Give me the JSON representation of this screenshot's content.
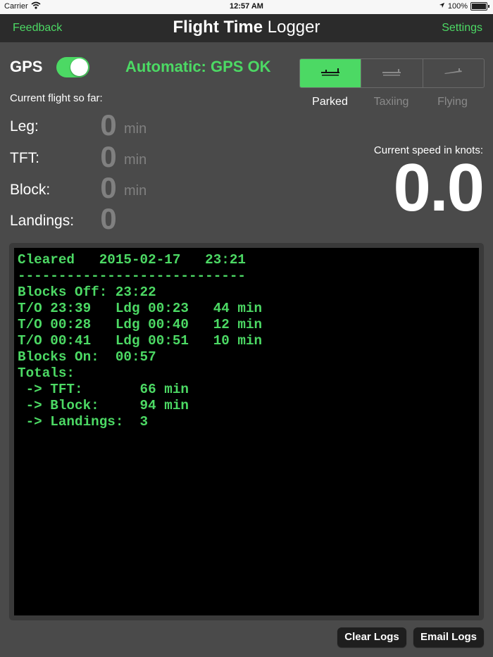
{
  "status_bar": {
    "carrier": "Carrier",
    "time": "12:57 AM",
    "battery": "100%"
  },
  "nav": {
    "left": "Feedback",
    "title_bold": "Flight Time",
    "title_light": "Logger",
    "right": "Settings"
  },
  "gps": {
    "label": "GPS",
    "toggle_on": true,
    "status": "Automatic:  GPS OK"
  },
  "flight_state": {
    "options": [
      "Parked",
      "Taxiing",
      "Flying"
    ],
    "selected": "Parked"
  },
  "current_flight": {
    "title": "Current flight so far:",
    "rows": [
      {
        "label": "Leg:",
        "value": "0",
        "unit": "min"
      },
      {
        "label": "TFT:",
        "value": "0",
        "unit": "min"
      },
      {
        "label": "Block:",
        "value": "0",
        "unit": "min"
      },
      {
        "label": "Landings:",
        "value": "0",
        "unit": ""
      }
    ]
  },
  "speed": {
    "label": "Current speed in knots:",
    "value": "0.0"
  },
  "log_lines": [
    "Cleared   2015-02-17   23:21",
    "----------------------------",
    "Blocks Off: 23:22",
    "T/O 23:39   Ldg 00:23   44 min",
    "T/O 00:28   Ldg 00:40   12 min",
    "T/O 00:41   Ldg 00:51   10 min",
    "Blocks On:  00:57",
    "Totals:",
    " -> TFT:       66 min",
    " -> Block:     94 min",
    " -> Landings:  3"
  ],
  "buttons": {
    "clear": "Clear Logs",
    "email": "Email Logs"
  },
  "colors": {
    "accent": "#4cd964",
    "background": "#4a4a4a",
    "navbar": "#2b2b2b",
    "log_background": "#000000"
  }
}
